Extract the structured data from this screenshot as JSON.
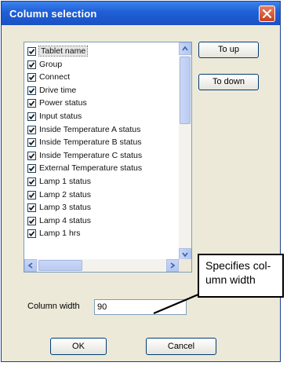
{
  "window": {
    "title": "Column selection",
    "close_label": "×"
  },
  "columns": [
    {
      "label": "Tablet name",
      "checked": true,
      "selected": true
    },
    {
      "label": "Group",
      "checked": true
    },
    {
      "label": "Connect",
      "checked": true
    },
    {
      "label": "Drive time",
      "checked": true
    },
    {
      "label": "Power status",
      "checked": true
    },
    {
      "label": "Input status",
      "checked": true
    },
    {
      "label": "Inside Temperature A status",
      "checked": true
    },
    {
      "label": "Inside Temperature B status",
      "checked": true
    },
    {
      "label": "Inside Temperature C status",
      "checked": true
    },
    {
      "label": "External Temperature status",
      "checked": true
    },
    {
      "label": "Lamp 1 status",
      "checked": true
    },
    {
      "label": "Lamp 2 status",
      "checked": true
    },
    {
      "label": "Lamp 3 status",
      "checked": true
    },
    {
      "label": "Lamp 4 status",
      "checked": true
    },
    {
      "label": "Lamp 1 hrs",
      "checked": true
    }
  ],
  "buttons": {
    "up": "To up",
    "down": "To down",
    "ok": "OK",
    "cancel": "Cancel"
  },
  "width_field": {
    "label": "Column width",
    "value": "90"
  },
  "callout": {
    "line1": "Specifies col-",
    "line2": "umn width"
  },
  "colors": {
    "titlebar": "#1f5fd6",
    "dialog_bg": "#ece9d8",
    "border": "#003c74"
  }
}
